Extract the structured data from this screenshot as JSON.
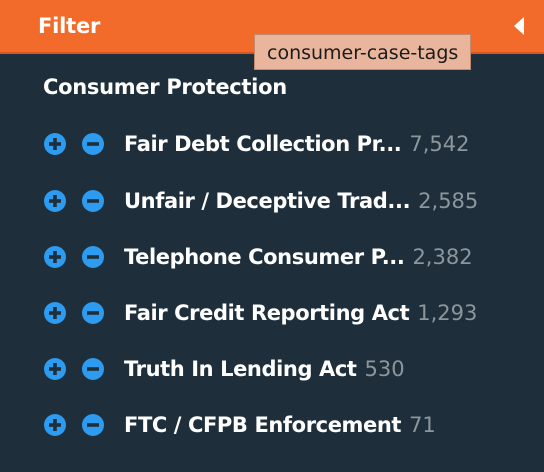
{
  "header": {
    "title": "Filter",
    "collapse_icon": "caret-left-icon"
  },
  "tooltip": {
    "text": "consumer-case-tags"
  },
  "section": {
    "title": "Consumer Protection"
  },
  "filters": [
    {
      "label": "Fair Debt Collection Pr...",
      "count": "7,542"
    },
    {
      "label": "Unfair / Deceptive Trad...",
      "count": "2,585"
    },
    {
      "label": "Telephone Consumer P...",
      "count": "2,382"
    },
    {
      "label": "Fair Credit Reporting Act",
      "count": "1,293"
    },
    {
      "label": "Truth In Lending Act",
      "count": "530"
    },
    {
      "label": "FTC / CFPB Enforcement",
      "count": "71"
    }
  ],
  "icons": {
    "include": "plus-circle-icon",
    "exclude": "minus-circle-icon"
  },
  "colors": {
    "header_bg": "#f26b2b",
    "panel_bg": "#1e2f3b",
    "button_blue": "#2d9bf0",
    "count_gray": "#8c969d",
    "tooltip_bg": "#e9b69d"
  }
}
